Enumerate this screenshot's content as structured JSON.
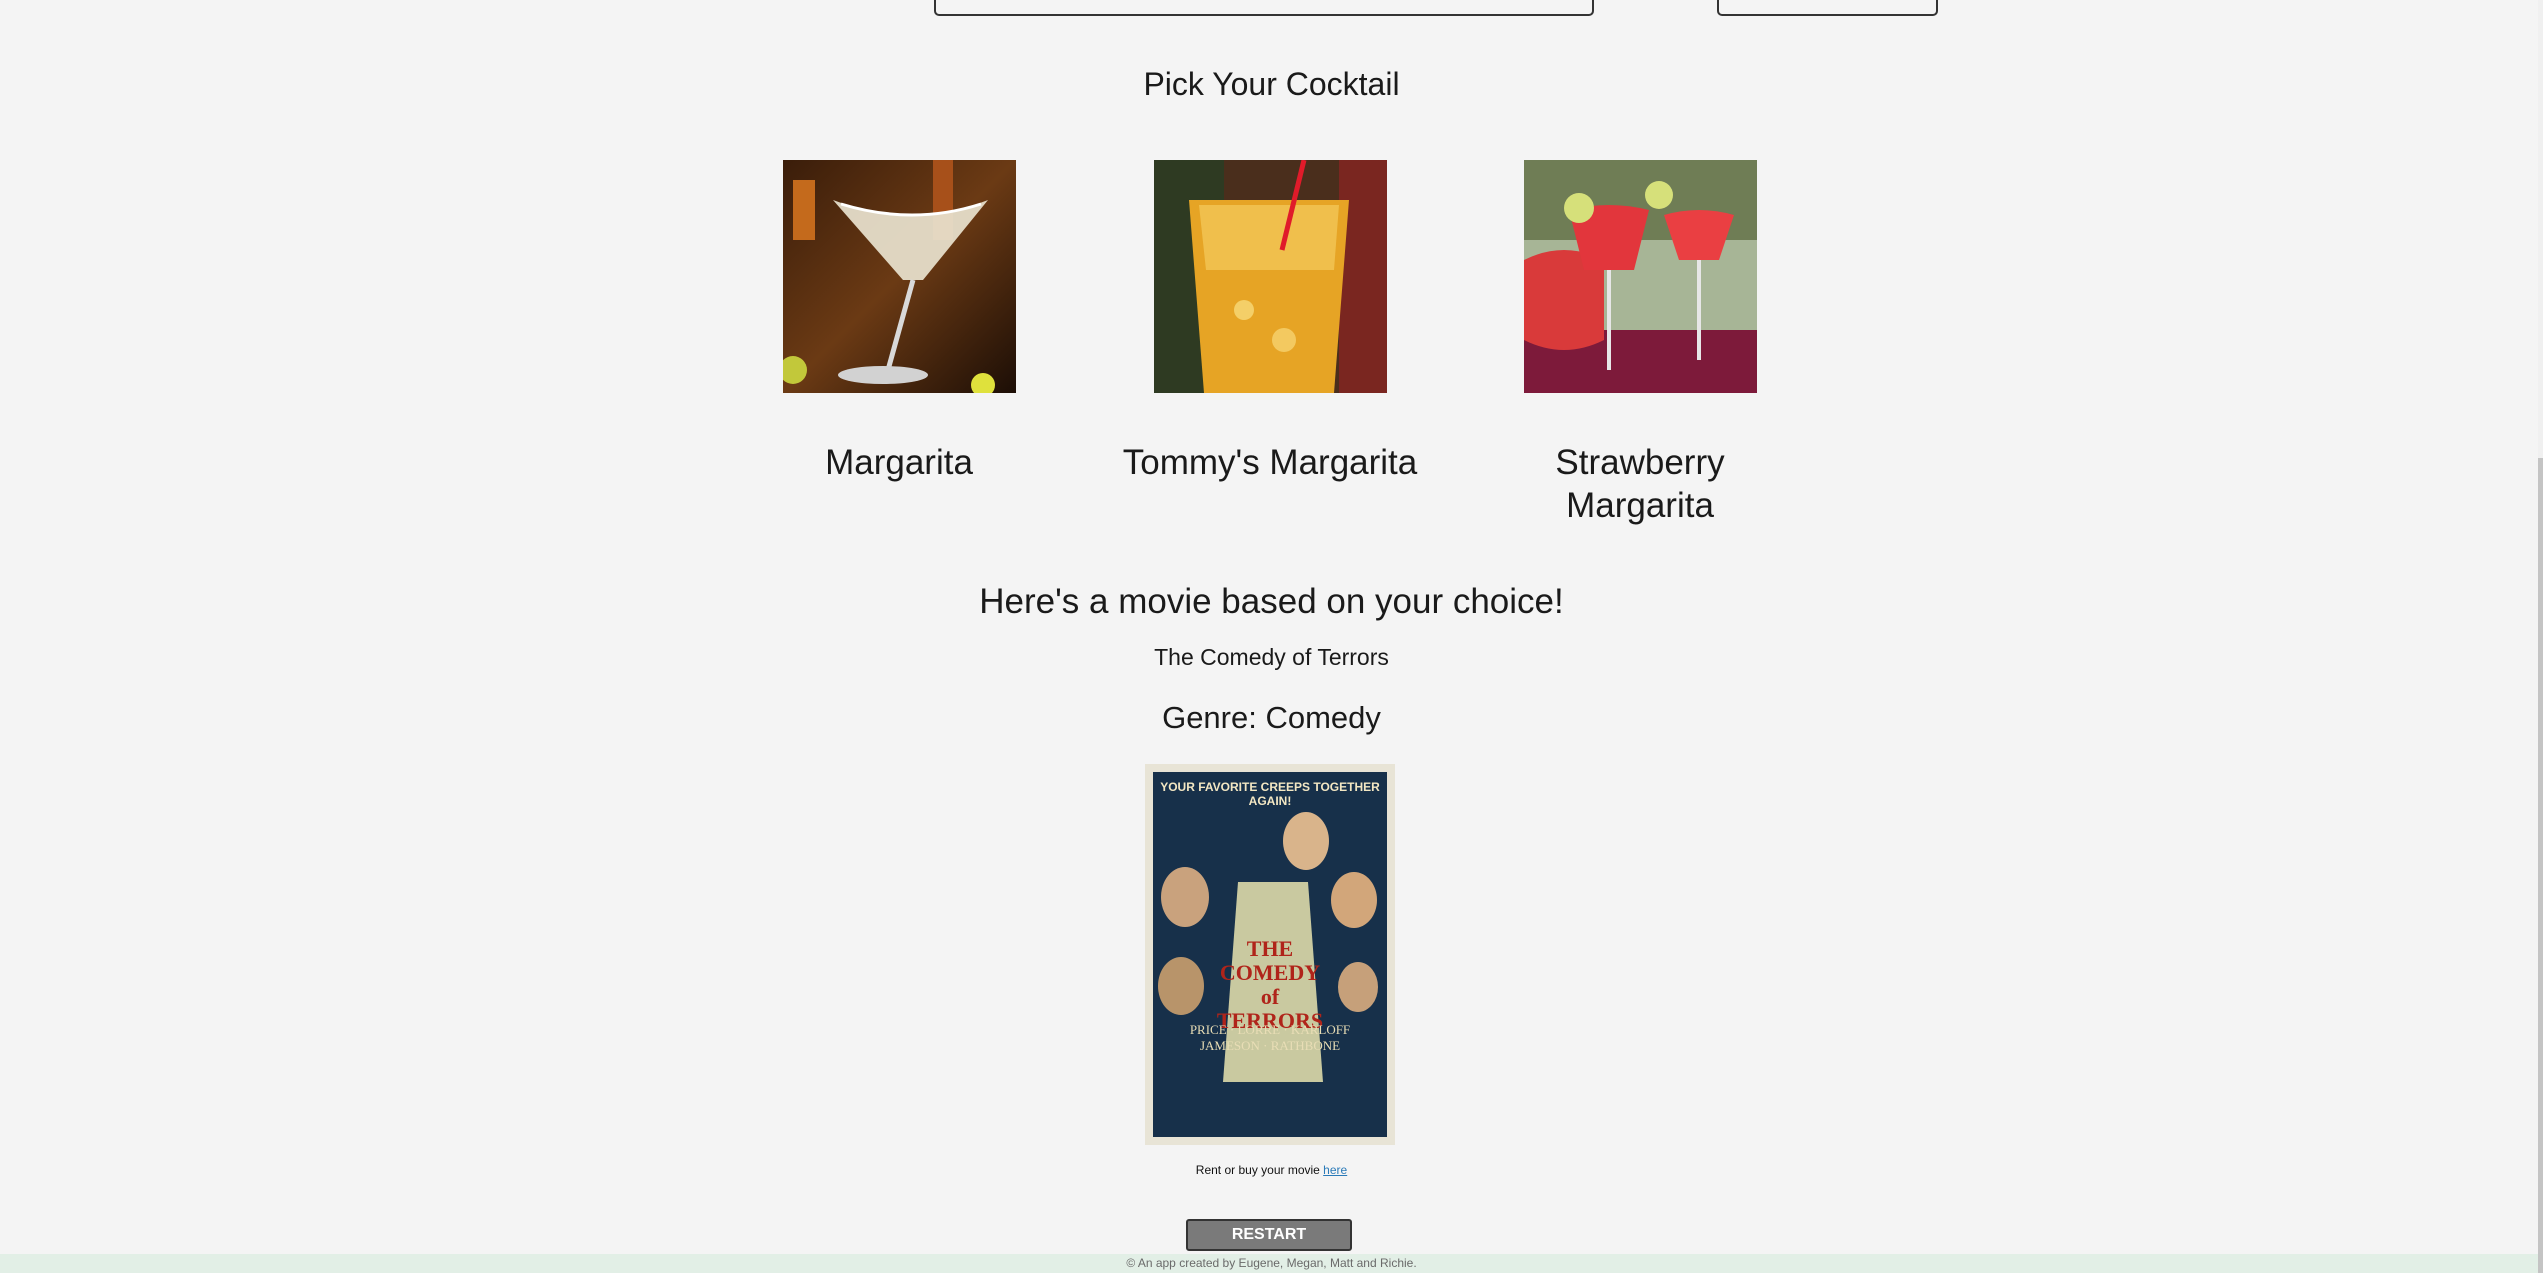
{
  "sections": {
    "cocktail_heading": "Pick Your Cocktail",
    "movie_heading": "Here's a movie based on your choice!"
  },
  "cocktails": [
    {
      "name": "Margarita",
      "image": "margarita-cocktail-photo"
    },
    {
      "name": "Tommy's Margarita",
      "image": "tommys-margarita-cocktail-photo"
    },
    {
      "name": "Strawberry Margarita",
      "image": "strawberry-margarita-cocktail-photo"
    }
  ],
  "movie": {
    "title": "The Comedy of Terrors",
    "genre": "Genre: Comedy",
    "poster": {
      "tagline": "YOUR FAVORITE CREEPS TOGETHER AGAIN!",
      "title_line1": "THE",
      "title_line2": "COMEDY",
      "title_line3": "of",
      "title_line4": "TERRORS",
      "names_line1": "PRICE · LORRE · KARLOFF",
      "names_line2": "JAMESON · RATHBONE"
    },
    "rent_prefix": "Rent or buy your movie ",
    "rent_link": "here"
  },
  "restart_label": "RESTART",
  "footer_text": "© An app created by Eugene, Megan, Matt and Richie.",
  "colors": {
    "background": "#f4f4f4",
    "footer_background": "#e2efe6",
    "restart_button": "#7a7a7a",
    "link": "#2a7ab8"
  }
}
